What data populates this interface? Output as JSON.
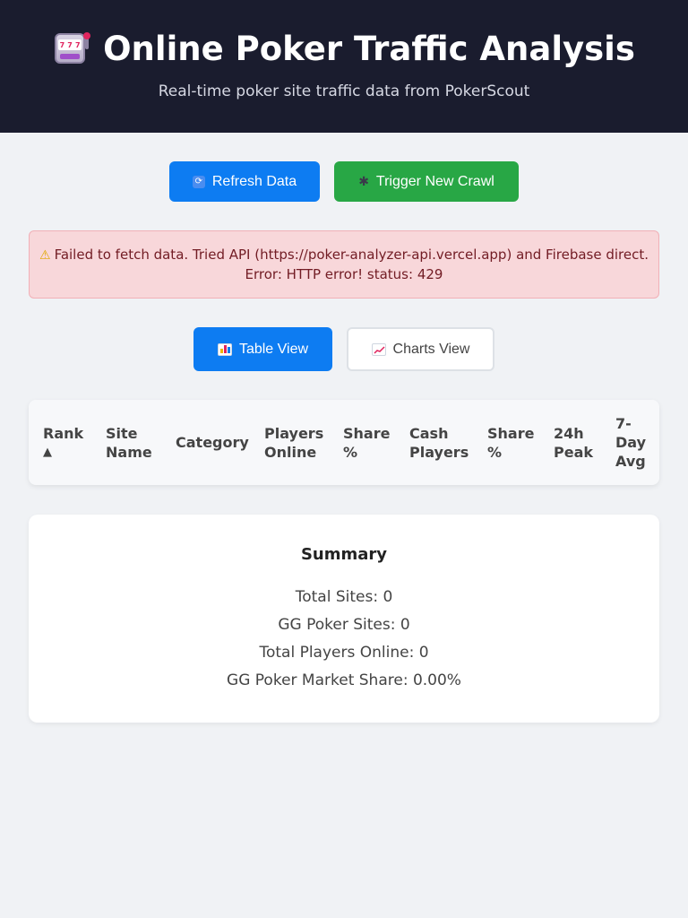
{
  "header": {
    "title": "Online Poker Traffic Analysis",
    "subtitle": "Real-time poker site traffic data from PokerScout",
    "icon": "slot-machine-icon"
  },
  "actions": {
    "refresh_label": "Refresh Data",
    "crawl_label": "Trigger New Crawl"
  },
  "alert": {
    "line1": "Failed to fetch data. Tried API (https://poker-analyzer-api.vercel.app) and Firebase direct.",
    "line2": "Error: HTTP error! status: 429"
  },
  "views": {
    "table_label": "Table View",
    "charts_label": "Charts View",
    "active": "table"
  },
  "table": {
    "columns": [
      {
        "line1": "Rank",
        "line2": "▲"
      },
      {
        "line1": "Site",
        "line2": "Name"
      },
      {
        "line1": "Category",
        "line2": ""
      },
      {
        "line1": "Players",
        "line2": "Online"
      },
      {
        "line1": "Share",
        "line2": "%"
      },
      {
        "line1": "Cash",
        "line2": "Players"
      },
      {
        "line1": "Share",
        "line2": "%"
      },
      {
        "line1": "24h",
        "line2": "Peak"
      },
      {
        "line1": "7-",
        "line2": "Day",
        "line3": "Avg"
      }
    ],
    "rows": []
  },
  "summary": {
    "title": "Summary",
    "total_sites": "Total Sites: 0",
    "gg_sites": "GG Poker Sites: 0",
    "total_players": "Total Players Online: 0",
    "gg_share": "GG Poker Market Share: 0.00%"
  },
  "colors": {
    "header_bg": "#1a1c2e",
    "primary": "#0d7cf2",
    "success": "#28a745",
    "alert_bg": "#f8d7da",
    "alert_text": "#721c24"
  }
}
